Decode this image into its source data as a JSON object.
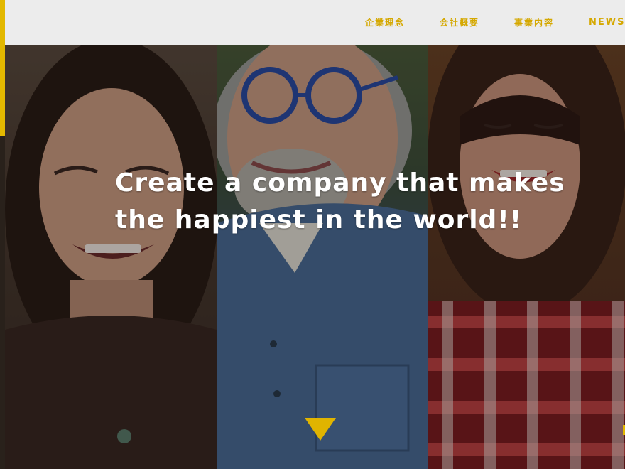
{
  "nav": {
    "items": [
      {
        "label": "企業理念"
      },
      {
        "label": "会社概要"
      },
      {
        "label": "事業内容"
      },
      {
        "label": "NEWS"
      }
    ]
  },
  "hero": {
    "headline_line1": "Create a company that makes",
    "headline_line2": "the happiest in the world!!",
    "photos": [
      "laughing-woman-photo",
      "smiling-older-man-with-glasses-photo",
      "smiling-woman-red-plaid-photo"
    ]
  },
  "colors": {
    "accent": "#e3b800",
    "nav_text": "#d5a800",
    "header_bg": "#ececec",
    "headline": "#ffffff"
  }
}
